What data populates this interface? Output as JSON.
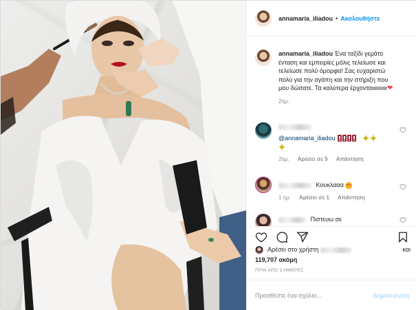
{
  "post": {
    "username": "annamaria_iliadou",
    "follow_label": "Ακολουθήστε",
    "separator": "•"
  },
  "caption": {
    "username": "annamaria_iliadou",
    "text": "Ένα ταξίδι γεμάτο ένταση και εμπειρίες μόλις τελείωσε και τελείωσε πολύ όμορφα! Σας ευχαριστώ πολύ για την αγάπη και την στήριξη που μου δώσατε. Τα καλύτερα έρχονταιιιιιιιιιιι",
    "time": "2ημ."
  },
  "comments": [
    {
      "mention": "@annamaria_iliadou",
      "time": "2ημ.",
      "likes": "Αρέσει σε 5",
      "reply": "Απάντηση"
    },
    {
      "text": "Κουκλααα",
      "time": "1 ημ.",
      "likes": "Αρέσει σε 1",
      "reply": "Απάντηση"
    },
    {
      "text": "Πιστευω σε"
    }
  ],
  "likes": {
    "prefix": "Αρέσει στο χρήστη",
    "and": "και",
    "count": "119,707 ακόμη"
  },
  "date": "ΠΡΙΝ ΑΠΟ 2 ΗΜΕΡΕΣ",
  "add_comment": {
    "placeholder": "Προσθέστε ένα σχόλιο...",
    "post_label": "Δημοσίευση"
  },
  "icons": {
    "like": "heart-icon",
    "comment": "comment-icon",
    "share": "share-icon",
    "save": "bookmark-icon"
  },
  "colors": {
    "accent": "#0095f6",
    "post_disabled": "#b2dffc",
    "meta": "#8e8e8e",
    "heart": "#ed4956"
  }
}
